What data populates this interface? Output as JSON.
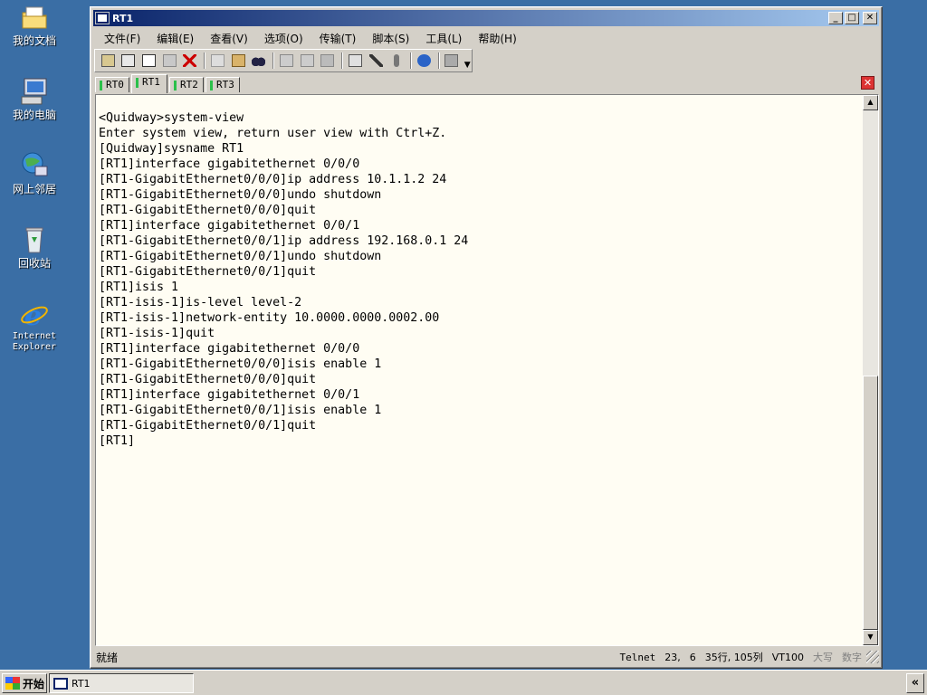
{
  "desktop": {
    "icons": [
      {
        "label": "我的文档",
        "icon": "folder-icon"
      },
      {
        "label": "我的电脑",
        "icon": "computer-icon"
      },
      {
        "label": "网上邻居",
        "icon": "network-icon"
      },
      {
        "label": "回收站",
        "icon": "recycle-bin-icon"
      },
      {
        "label": "Internet Explorer",
        "icon": "ie-icon"
      }
    ]
  },
  "window": {
    "title": "RT1",
    "controls": {
      "minimize": "_",
      "maximize": "□",
      "close": "✕"
    },
    "menu": [
      "文件(F)",
      "编辑(E)",
      "查看(V)",
      "选项(O)",
      "传输(T)",
      "脚本(S)",
      "工具(L)",
      "帮助(H)"
    ],
    "tabs": [
      "RT0",
      "RT1",
      "RT2",
      "RT3"
    ],
    "active_tab": "RT1",
    "tab_close": "✕"
  },
  "terminal": {
    "lines": [
      "<Quidway>system-view",
      "Enter system view, return user view with Ctrl+Z.",
      "[Quidway]sysname RT1",
      "[RT1]interface gigabitethernet 0/0/0",
      "[RT1-GigabitEthernet0/0/0]ip address 10.1.1.2 24",
      "[RT1-GigabitEthernet0/0/0]undo shutdown",
      "[RT1-GigabitEthernet0/0/0]quit",
      "[RT1]interface gigabitethernet 0/0/1",
      "[RT1-GigabitEthernet0/0/1]ip address 192.168.0.1 24",
      "[RT1-GigabitEthernet0/0/1]undo shutdown",
      "[RT1-GigabitEthernet0/0/1]quit",
      "[RT1]isis 1",
      "[RT1-isis-1]is-level level-2",
      "[RT1-isis-1]network-entity 10.0000.0000.0002.00",
      "[RT1-isis-1]quit",
      "[RT1]interface gigabitethernet 0/0/0",
      "[RT1-GigabitEthernet0/0/0]isis enable 1",
      "[RT1-GigabitEthernet0/0/0]quit",
      "[RT1]interface gigabitethernet 0/0/1",
      "[RT1-GigabitEthernet0/0/1]isis enable 1",
      "[RT1-GigabitEthernet0/0/1]quit",
      "[RT1]"
    ]
  },
  "status": {
    "ready": "就绪",
    "protocol": "Telnet",
    "row": "23,",
    "col": "6",
    "size": "35行, 105列",
    "emulation": "VT100",
    "caps": "大写",
    "num": "数字"
  },
  "taskbar": {
    "start_label": "开始",
    "task_label": "RT1",
    "tray_arrow": "«"
  },
  "colors": {
    "desktop": "#3a6ea5",
    "title_gradient_start": "#0a246a",
    "terminal_bg": "#fffdf3",
    "tab_indicator": "#2bc04a"
  }
}
